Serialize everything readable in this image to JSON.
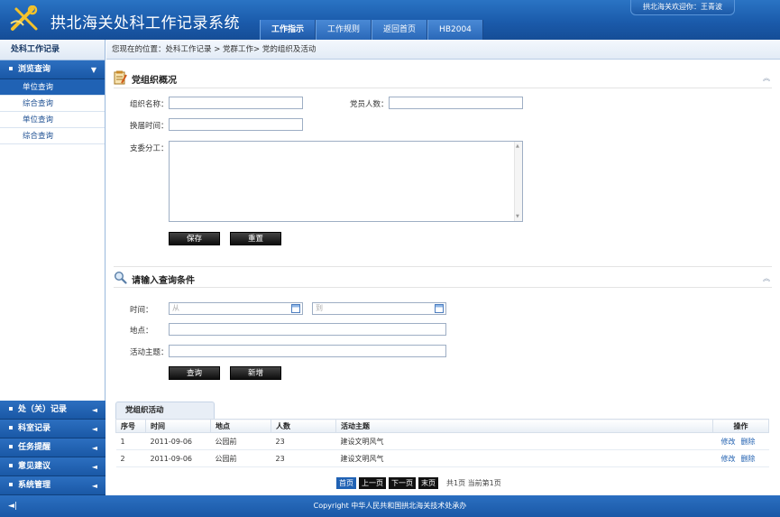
{
  "header": {
    "app_title": "拱北海关处科工作记录系统",
    "welcome": "拱北海关欢迎你：王青波",
    "tabs": [
      {
        "label": "工作指示",
        "active": true
      },
      {
        "label": "工作规则",
        "active": false
      },
      {
        "label": "返回首页",
        "active": false
      },
      {
        "label": "HB2004",
        "active": false
      }
    ]
  },
  "sidebar": {
    "title": "处科工作记录",
    "top_menu": {
      "label": "浏览查询",
      "arrow": "▼"
    },
    "items": [
      {
        "label": "单位查询",
        "selected": true
      },
      {
        "label": "综合查询",
        "selected": false
      },
      {
        "label": "单位查询",
        "selected": false
      },
      {
        "label": "综合查询",
        "selected": false
      }
    ],
    "bottom_menus": [
      {
        "label": "处（关）记录",
        "arrow": "◄"
      },
      {
        "label": "科室记录",
        "arrow": "◄"
      },
      {
        "label": "任务提醒",
        "arrow": "◄"
      },
      {
        "label": "意见建议",
        "arrow": "◄"
      },
      {
        "label": "系统管理",
        "arrow": "◄"
      }
    ]
  },
  "breadcrumb": "您现在的位置：处科工作记录 > 党群工作> 党的组织及活动",
  "org_section": {
    "title": "党组织概况",
    "org_name_label": "组织名称：",
    "member_count_label": "党员人数：",
    "term_time_label": "换届时间：",
    "division_label": "支委分工：",
    "save_label": "保存",
    "reset_label": "重置"
  },
  "query_section": {
    "title": "请输入查询条件",
    "time_label": "时间：",
    "from_placeholder": "从",
    "to_placeholder": "到",
    "location_label": "地点：",
    "theme_label": "活动主题：",
    "query_label": "查询",
    "add_label": "新增"
  },
  "activities": {
    "tab_label": "党组织活动",
    "columns": [
      "序号",
      "时间",
      "地点",
      "人数",
      "活动主题",
      "操作"
    ],
    "rows": [
      {
        "no": "1",
        "date": "2011-09-06",
        "place": "公园前",
        "count": "23",
        "theme": "建设文明风气",
        "edit": "修改",
        "delete": "删除"
      },
      {
        "no": "2",
        "date": "2011-09-06",
        "place": "公园前",
        "count": "23",
        "theme": "建设文明风气",
        "edit": "修改",
        "delete": "删除"
      }
    ],
    "pager": {
      "first": "首页",
      "prev": "上一页",
      "next": "下一页",
      "last": "末页",
      "info": "共1页 当前第1页"
    }
  },
  "footer": {
    "copyright": "Copyright  中华人民共和国拱北海关技术处承办",
    "toggle": "◄|"
  }
}
